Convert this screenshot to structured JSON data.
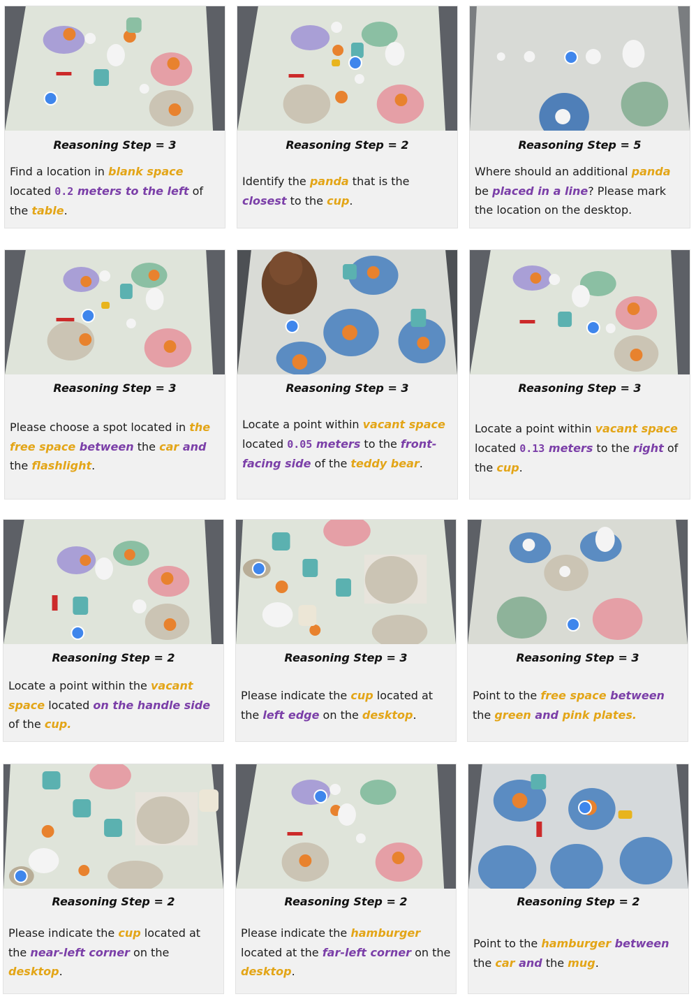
{
  "cards": [
    {
      "step": "Reasoning Step = 3",
      "segments": [
        {
          "t": "Find a location in ",
          "s": "n"
        },
        {
          "t": "blank space",
          "s": "y"
        },
        {
          "t": " located ",
          "s": "n"
        },
        {
          "t": "0.2",
          "s": "pm"
        },
        {
          "t": " meters to the left",
          "s": "p"
        },
        {
          "t": " of the ",
          "s": "n"
        },
        {
          "t": "table",
          "s": "y"
        },
        {
          "t": ".",
          "s": "n"
        }
      ]
    },
    {
      "step": "Reasoning Step = 2",
      "segments": [
        {
          "t": "Identify the ",
          "s": "n"
        },
        {
          "t": "panda",
          "s": "y"
        },
        {
          "t": " that is the ",
          "s": "n"
        },
        {
          "t": "closest",
          "s": "p"
        },
        {
          "t": " to the ",
          "s": "n"
        },
        {
          "t": "cup",
          "s": "y"
        },
        {
          "t": ".",
          "s": "n"
        }
      ]
    },
    {
      "step": "Reasoning Step = 5",
      "segments": [
        {
          "t": "Where should an additional ",
          "s": "n"
        },
        {
          "t": "panda",
          "s": "y"
        },
        {
          "t": " be ",
          "s": "n"
        },
        {
          "t": "placed in a line",
          "s": "p"
        },
        {
          "t": "? Please mark the location on the desktop.",
          "s": "n"
        }
      ]
    },
    {
      "step": "Reasoning Step = 3",
      "segments": [
        {
          "t": "Please choose a spot located in ",
          "s": "n"
        },
        {
          "t": "the free space",
          "s": "y"
        },
        {
          "t": " between",
          "s": "p"
        },
        {
          "t": " the ",
          "s": "n"
        },
        {
          "t": "car",
          "s": "y"
        },
        {
          "t": " and",
          "s": "p"
        },
        {
          "t": " the ",
          "s": "n"
        },
        {
          "t": "flashlight",
          "s": "y"
        },
        {
          "t": ".",
          "s": "n"
        }
      ]
    },
    {
      "step": "Reasoning Step = 3",
      "segments": [
        {
          "t": "Locate a point within ",
          "s": "n"
        },
        {
          "t": "vacant space",
          "s": "y"
        },
        {
          "t": " located ",
          "s": "n"
        },
        {
          "t": "0.05",
          "s": "pm"
        },
        {
          "t": " meters",
          "s": "p"
        },
        {
          "t": " to the ",
          "s": "n"
        },
        {
          "t": "front-facing side",
          "s": "p"
        },
        {
          "t": " of the ",
          "s": "n"
        },
        {
          "t": "teddy bear",
          "s": "y"
        },
        {
          "t": ".",
          "s": "n"
        }
      ]
    },
    {
      "step": "Reasoning Step = 3",
      "segments": [
        {
          "t": "Locate a point within ",
          "s": "n"
        },
        {
          "t": "vacant space",
          "s": "y"
        },
        {
          "t": " located ",
          "s": "n"
        },
        {
          "t": "0.13",
          "s": "pm"
        },
        {
          "t": " meters",
          "s": "p"
        },
        {
          "t": " to the ",
          "s": "n"
        },
        {
          "t": "right",
          "s": "p"
        },
        {
          "t": " of the ",
          "s": "n"
        },
        {
          "t": "cup",
          "s": "y"
        },
        {
          "t": ".",
          "s": "n"
        }
      ]
    },
    {
      "step": "Reasoning Step = 2",
      "segments": [
        {
          "t": "Locate a point within the ",
          "s": "n"
        },
        {
          "t": "vacant space",
          "s": "y"
        },
        {
          "t": " located ",
          "s": "n"
        },
        {
          "t": "on the handle side",
          "s": "p"
        },
        {
          "t": " of the ",
          "s": "n"
        },
        {
          "t": "cup.",
          "s": "y"
        }
      ]
    },
    {
      "step": "Reasoning Step = 3",
      "segments": [
        {
          "t": "Please indicate the ",
          "s": "n"
        },
        {
          "t": "cup",
          "s": "y"
        },
        {
          "t": " located at the ",
          "s": "n"
        },
        {
          "t": "left edge",
          "s": "p"
        },
        {
          "t": "  on the ",
          "s": "n"
        },
        {
          "t": "desktop",
          "s": "y"
        },
        {
          "t": ".",
          "s": "n"
        }
      ]
    },
    {
      "step": "Reasoning Step = 3",
      "segments": [
        {
          "t": "Point to the ",
          "s": "n"
        },
        {
          "t": "free space",
          "s": "y"
        },
        {
          "t": " between",
          "s": "p"
        },
        {
          "t": " the ",
          "s": "n"
        },
        {
          "t": "green",
          "s": "y"
        },
        {
          "t": " and",
          "s": "p"
        },
        {
          "t": "  pink plates.",
          "s": "y"
        }
      ]
    },
    {
      "step": "Reasoning Step = 2",
      "segments": [
        {
          "t": "Please indicate the ",
          "s": "n"
        },
        {
          "t": "cup",
          "s": "y"
        },
        {
          "t": " located at the ",
          "s": "n"
        },
        {
          "t": "near-left corner",
          "s": "p"
        },
        {
          "t": "  on the ",
          "s": "n"
        },
        {
          "t": "desktop",
          "s": "y"
        },
        {
          "t": ".",
          "s": "n"
        }
      ]
    },
    {
      "step": "Reasoning Step = 2",
      "segments": [
        {
          "t": "Please indicate the ",
          "s": "n"
        },
        {
          "t": "hamburger",
          "s": "y"
        },
        {
          "t": " located at the ",
          "s": "n"
        },
        {
          "t": "far-left corner",
          "s": "p"
        },
        {
          "t": "  on the ",
          "s": "n"
        },
        {
          "t": "desktop",
          "s": "y"
        },
        {
          "t": ".",
          "s": "n"
        }
      ]
    },
    {
      "step": "Reasoning Step = 2",
      "segments": [
        {
          "t": "Point to the ",
          "s": "n"
        },
        {
          "t": "hamburger",
          "s": "y"
        },
        {
          "t": " between",
          "s": "p"
        },
        {
          "t": " the ",
          "s": "n"
        },
        {
          "t": "car",
          "s": "y"
        },
        {
          "t": " and",
          "s": "p"
        },
        {
          "t": " the ",
          "s": "n"
        },
        {
          "t": "mug",
          "s": "y"
        },
        {
          "t": ".",
          "s": "n"
        }
      ]
    }
  ],
  "colors": {
    "object_highlight": "#e3a517",
    "relation_highlight": "#7b3fa8",
    "target_marker": "#3f86ec",
    "panel_background": "#f1f1f1"
  }
}
